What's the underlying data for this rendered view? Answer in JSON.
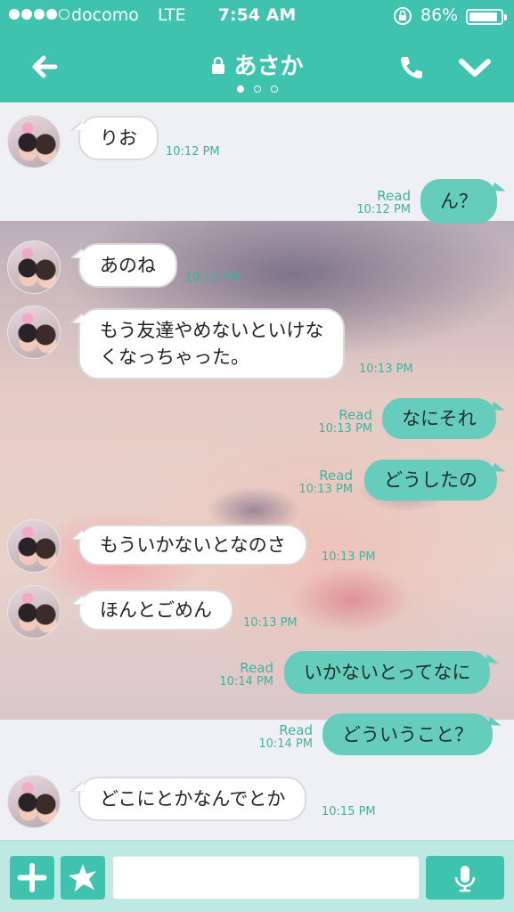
{
  "status_bar": {
    "carrier": "docomo",
    "network": "LTE",
    "time": "7:54 AM",
    "battery_pct": "86%",
    "battery_level": 0.86,
    "signal_bars_filled": 4,
    "signal_bars_total": 5
  },
  "header": {
    "title": "あさか",
    "page_index": 0,
    "page_count": 3,
    "accent": "#3fc3ae"
  },
  "messages": [
    {
      "dir": "in",
      "text": "りお",
      "time": "10:12 PM"
    },
    {
      "dir": "out",
      "text": "ん？",
      "read": "Read",
      "time": "10:12 PM"
    },
    {
      "dir": "in",
      "text": "あのね",
      "time": "10:12 PM"
    },
    {
      "dir": "in",
      "text_lines": [
        "もう友達やめないといけな",
        "くなっちゃった。"
      ],
      "time": "10:13 PM"
    },
    {
      "dir": "out",
      "text": "なにそれ",
      "read": "Read",
      "time": "10:13 PM"
    },
    {
      "dir": "out",
      "text": "どうしたの",
      "read": "Read",
      "time": "10:13 PM"
    },
    {
      "dir": "in",
      "text": "もういかないとなのさ",
      "time": "10:13 PM"
    },
    {
      "dir": "in",
      "text": "ほんとごめん",
      "time": "10:13 PM"
    },
    {
      "dir": "out",
      "text": "いかないとってなに",
      "read": "Read",
      "time": "10:14 PM"
    },
    {
      "dir": "out",
      "text": "どういうこと？",
      "read": "Read",
      "time": "10:14 PM"
    },
    {
      "dir": "in",
      "text": "どこにとかなんでとか",
      "time": "10:15 PM"
    }
  ],
  "input_bar": {
    "placeholder": "",
    "icons": [
      "plus-icon",
      "sticker-icon",
      "mic-icon"
    ]
  }
}
